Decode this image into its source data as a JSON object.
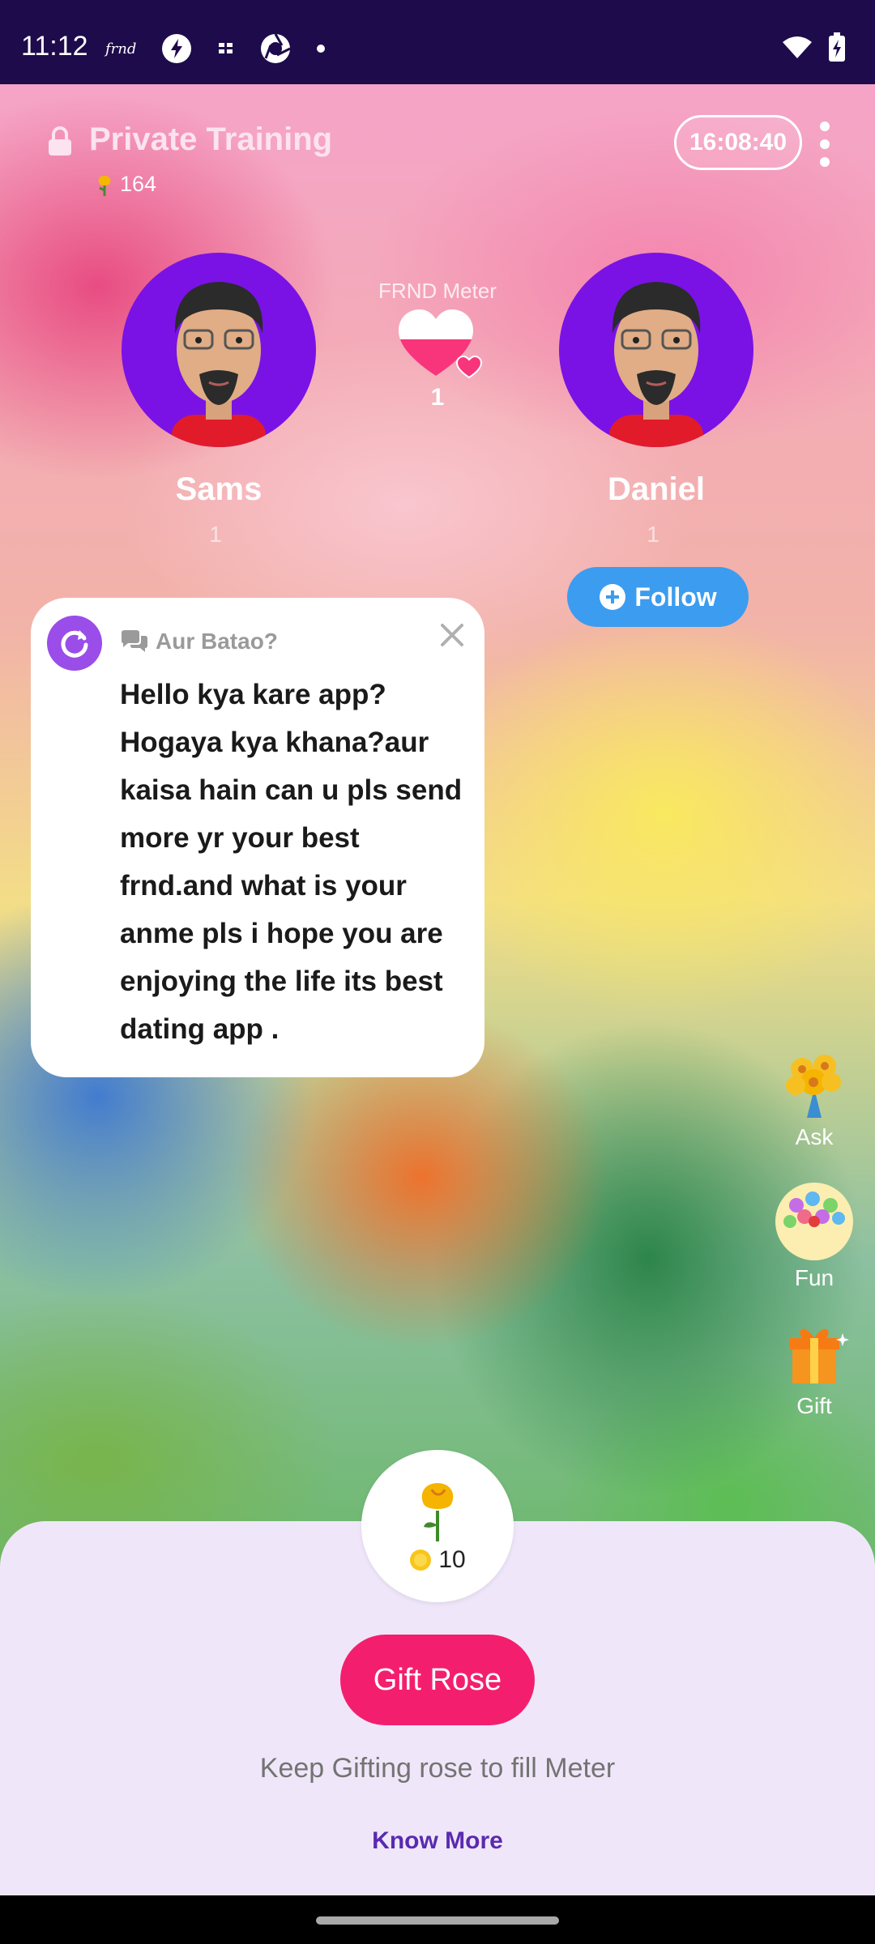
{
  "status_bar": {
    "time": "11:12",
    "app_label": "frnd"
  },
  "room": {
    "title": "Private Training",
    "rose_count": "164",
    "timer": "16:08:40"
  },
  "users": [
    {
      "name": "Sams",
      "count": "1"
    },
    {
      "name": "Daniel",
      "count": "1"
    }
  ],
  "meter": {
    "label": "FRND Meter",
    "value": "1",
    "fill_fraction": 0.55
  },
  "follow": {
    "label": "Follow"
  },
  "chat": {
    "prompt": "Aur Batao?",
    "message": "Hello kya kare app? Hogaya kya khana?aur kaisa hain can u pls send more yr your best frnd.and what is your anme pls i hope you are enjoying the life its best dating app ."
  },
  "side_actions": [
    {
      "label": "Ask",
      "icon": "flower-bouquet-icon"
    },
    {
      "label": "Fun",
      "icon": "bubble-game-icon"
    },
    {
      "label": "Gift",
      "icon": "gift-box-icon"
    }
  ],
  "gift_sheet": {
    "price": "10",
    "button_label": "Gift Rose",
    "hint": "Keep Gifting rose to fill Meter",
    "know_more": "Know More"
  },
  "colors": {
    "accent_pink": "#f31f6e",
    "avatar_purple": "#7a12e6",
    "follow_blue": "#3c9cf0",
    "link_purple": "#5a2ab0"
  }
}
